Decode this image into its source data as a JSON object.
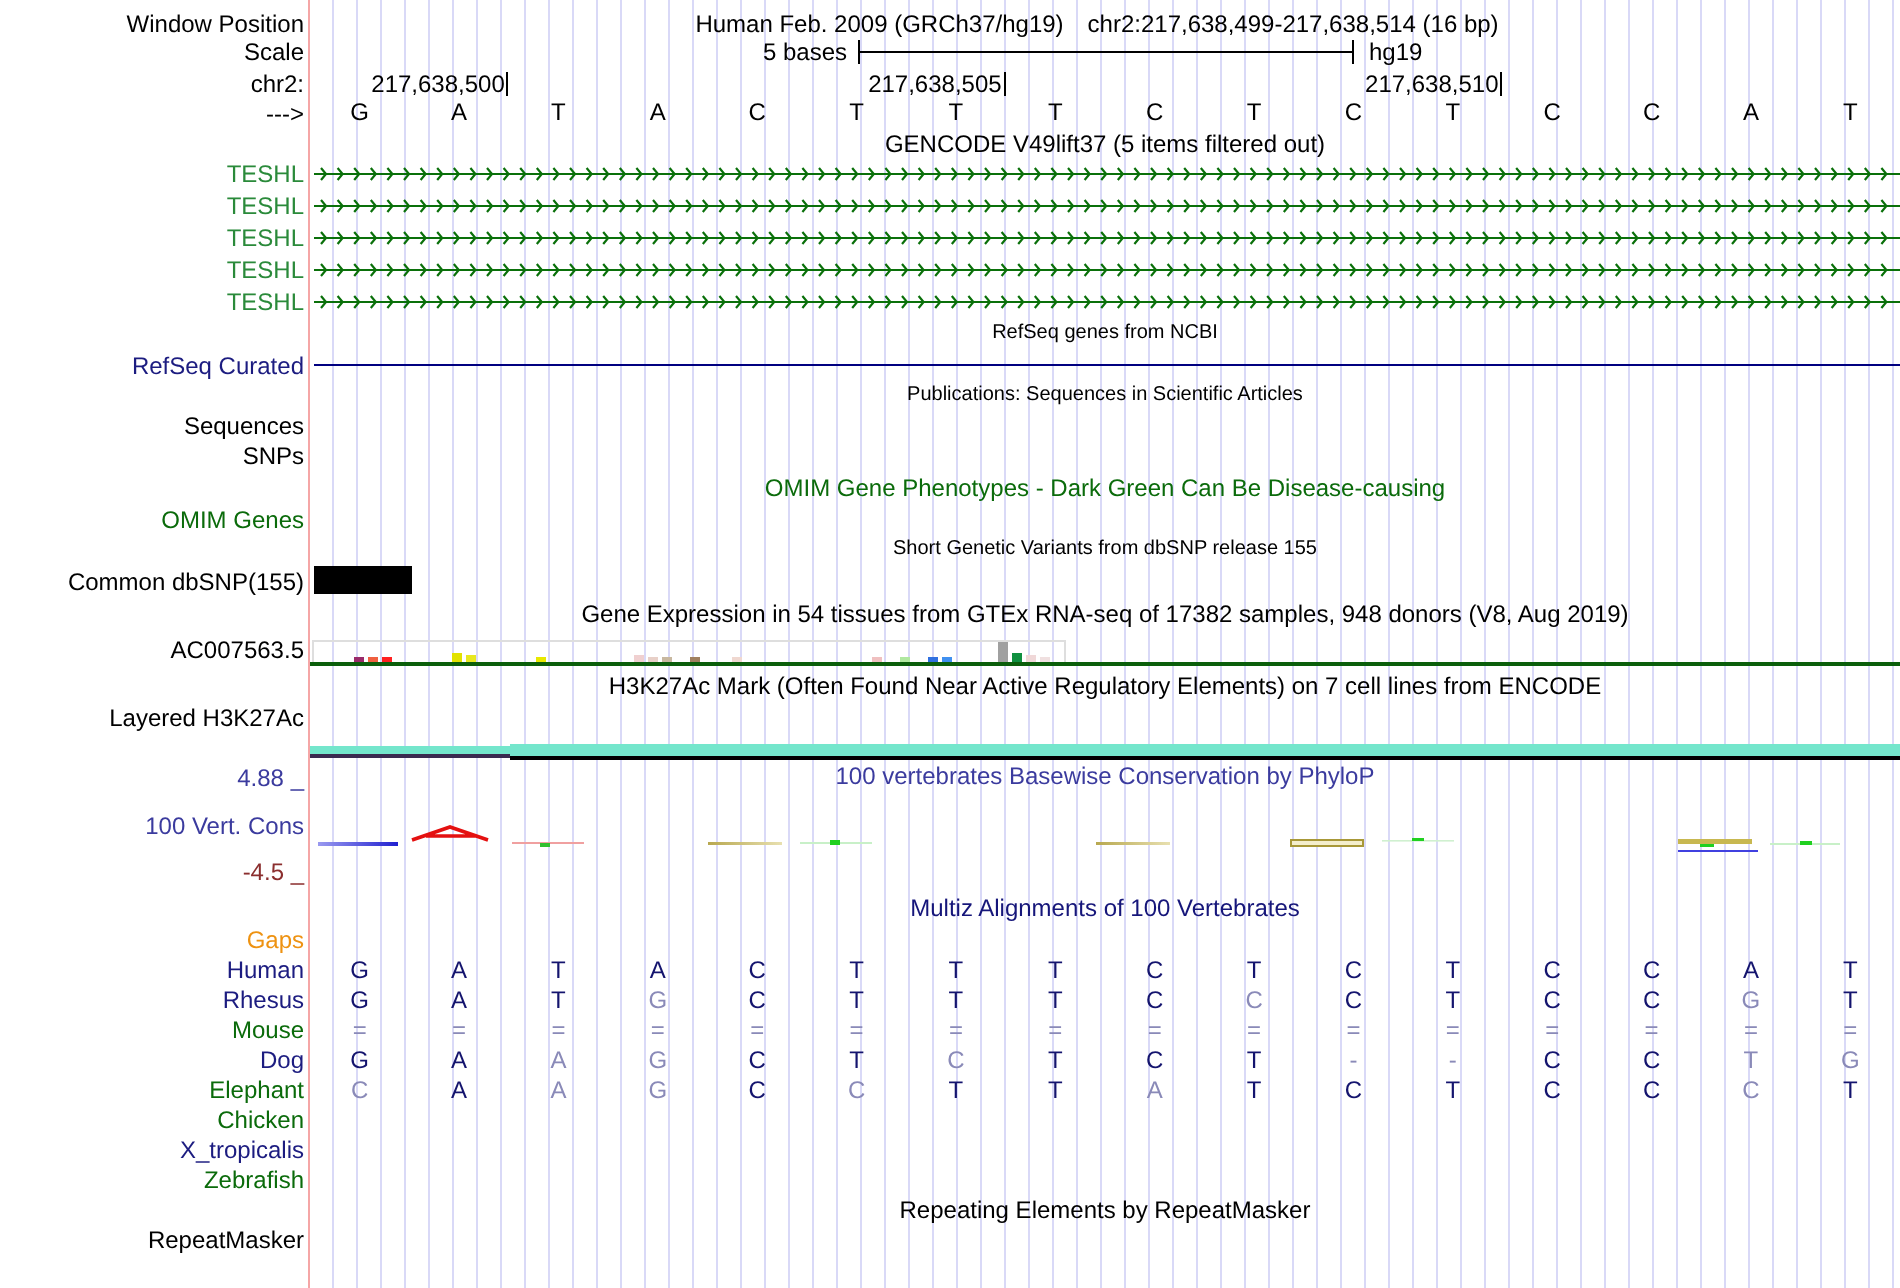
{
  "window_position": {
    "label": "Window Position",
    "assembly": "Human Feb. 2009 (GRCh37/hg19)",
    "range": "chr2:217,638,499-217,638,514 (16 bp)"
  },
  "scale": {
    "label": "Scale",
    "length": "5 bases",
    "assembly": "hg19"
  },
  "ruler": {
    "label": "chr2:",
    "positions": [
      "217,638,500",
      "217,638,505",
      "217,638,510"
    ]
  },
  "sequence": {
    "label": "--->",
    "bases": [
      "G",
      "A",
      "T",
      "A",
      "C",
      "T",
      "T",
      "T",
      "C",
      "T",
      "C",
      "T",
      "C",
      "C",
      "A",
      "T"
    ]
  },
  "tracks": [
    {
      "kind": "genes",
      "title": "GENCODE V49lift37 (5 items filtered out)",
      "items": [
        {
          "label": "TESHL",
          "color": "#2a8a3a"
        },
        {
          "label": "TESHL",
          "color": "#2a8a3a"
        },
        {
          "label": "TESHL",
          "color": "#2a8a3a"
        },
        {
          "label": "TESHL",
          "color": "#2a8a3a"
        },
        {
          "label": "TESHL",
          "color": "#2a8a3a"
        }
      ]
    },
    {
      "kind": "gene_line",
      "title": "RefSeq genes from NCBI",
      "label": "RefSeq Curated",
      "color": "#1c1c80"
    },
    {
      "kind": "labels",
      "title": "Publications: Sequences in Scientific Articles",
      "labels": [
        {
          "label": "Sequences",
          "color": "#000000"
        },
        {
          "label": "SNPs",
          "color": "#000000"
        }
      ]
    },
    {
      "kind": "phenotypes",
      "title": "OMIM Gene Phenotypes - Dark Green Can Be Disease-causing",
      "label": "OMIM Genes",
      "color": "#0b6b0b"
    },
    {
      "kind": "snps",
      "title": "Short Genetic Variants from dbSNP release 155",
      "label": "Common dbSNP(155)",
      "color": "#000000"
    },
    {
      "kind": "expression",
      "title": "Gene Expression in 54 tissues from GTEx RNA-seq of 17382 samples, 948 donors (V8, Aug 2019)",
      "label": "AC007563.5",
      "color": "#000000"
    },
    {
      "kind": "signal",
      "title": "H3K27Ac Mark (Often Found Near Active Regulatory Elements) on 7 cell lines from ENCODE",
      "label": "Layered H3K27Ac",
      "color": "#000000"
    },
    {
      "kind": "conservation",
      "title": "100 vertebrates Basewise Conservation by PhyloP",
      "label": "100 Vert. Cons",
      "color": "#3b3b9e",
      "axis_max": "4.88 _",
      "axis_min": "-4.5 _"
    },
    {
      "kind": "alignment",
      "title": "Multiz Alignments of 100 Vertebrates",
      "gaps": {
        "label": "Gaps",
        "color": "#ee9211"
      },
      "species": [
        {
          "name": "Human",
          "color": "#1c1c80",
          "bases": [
            {
              "base": "G",
              "match": true
            },
            {
              "base": "A",
              "match": true
            },
            {
              "base": "T",
              "match": true
            },
            {
              "base": "A",
              "match": true
            },
            {
              "base": "C",
              "match": true
            },
            {
              "base": "T",
              "match": true
            },
            {
              "base": "T",
              "match": true
            },
            {
              "base": "T",
              "match": true
            },
            {
              "base": "C",
              "match": true
            },
            {
              "base": "T",
              "match": true
            },
            {
              "base": "C",
              "match": true
            },
            {
              "base": "T",
              "match": true
            },
            {
              "base": "C",
              "match": true
            },
            {
              "base": "C",
              "match": true
            },
            {
              "base": "A",
              "match": true
            },
            {
              "base": "T",
              "match": true
            }
          ]
        },
        {
          "name": "Rhesus",
          "color": "#1c1c80",
          "bases": [
            {
              "base": "G",
              "match": true
            },
            {
              "base": "A",
              "match": true
            },
            {
              "base": "T",
              "match": true
            },
            {
              "base": "G",
              "match": false
            },
            {
              "base": "C",
              "match": true
            },
            {
              "base": "T",
              "match": true
            },
            {
              "base": "T",
              "match": true
            },
            {
              "base": "T",
              "match": true
            },
            {
              "base": "C",
              "match": true
            },
            {
              "base": "C",
              "match": false
            },
            {
              "base": "C",
              "match": true
            },
            {
              "base": "T",
              "match": true
            },
            {
              "base": "C",
              "match": true
            },
            {
              "base": "C",
              "match": true
            },
            {
              "base": "G",
              "match": false
            },
            {
              "base": "T",
              "match": true
            }
          ]
        },
        {
          "name": "Mouse",
          "color": "#0b6b0b",
          "bases": [
            {
              "base": "=",
              "match": false
            },
            {
              "base": "=",
              "match": false
            },
            {
              "base": "=",
              "match": false
            },
            {
              "base": "=",
              "match": false
            },
            {
              "base": "=",
              "match": false
            },
            {
              "base": "=",
              "match": false
            },
            {
              "base": "=",
              "match": false
            },
            {
              "base": "=",
              "match": false
            },
            {
              "base": "=",
              "match": false
            },
            {
              "base": "=",
              "match": false
            },
            {
              "base": "=",
              "match": false
            },
            {
              "base": "=",
              "match": false
            },
            {
              "base": "=",
              "match": false
            },
            {
              "base": "=",
              "match": false
            },
            {
              "base": "=",
              "match": false
            },
            {
              "base": "=",
              "match": false
            }
          ]
        },
        {
          "name": "Dog",
          "color": "#1c1c80",
          "bases": [
            {
              "base": "G",
              "match": true
            },
            {
              "base": "A",
              "match": true
            },
            {
              "base": "A",
              "match": false
            },
            {
              "base": "G",
              "match": false
            },
            {
              "base": "C",
              "match": true
            },
            {
              "base": "T",
              "match": true
            },
            {
              "base": "C",
              "match": false
            },
            {
              "base": "T",
              "match": true
            },
            {
              "base": "C",
              "match": true
            },
            {
              "base": "T",
              "match": true
            },
            {
              "base": "-",
              "match": false
            },
            {
              "base": "-",
              "match": false
            },
            {
              "base": "C",
              "match": true
            },
            {
              "base": "C",
              "match": true
            },
            {
              "base": "T",
              "match": false
            },
            {
              "base": "G",
              "match": false
            }
          ]
        },
        {
          "name": "Elephant",
          "color": "#0b6b0b",
          "bases": [
            {
              "base": "C",
              "match": false
            },
            {
              "base": "A",
              "match": true
            },
            {
              "base": "A",
              "match": false
            },
            {
              "base": "G",
              "match": false
            },
            {
              "base": "C",
              "match": true
            },
            {
              "base": "C",
              "match": false
            },
            {
              "base": "T",
              "match": true
            },
            {
              "base": "T",
              "match": true
            },
            {
              "base": "A",
              "match": false
            },
            {
              "base": "T",
              "match": true
            },
            {
              "base": "C",
              "match": true
            },
            {
              "base": "T",
              "match": true
            },
            {
              "base": "C",
              "match": true
            },
            {
              "base": "C",
              "match": true
            },
            {
              "base": "C",
              "match": false
            },
            {
              "base": "T",
              "match": true
            }
          ]
        },
        {
          "name": "Chicken",
          "color": "#0b6b0b"
        },
        {
          "name": "X_tropicalis",
          "color": "#1c1c80"
        },
        {
          "name": "Zebrafish",
          "color": "#0b6b0b"
        }
      ]
    },
    {
      "kind": "repeats",
      "title": "Repeating Elements by RepeatMasker",
      "label": "RepeatMasker",
      "color": "#000000"
    }
  ]
}
